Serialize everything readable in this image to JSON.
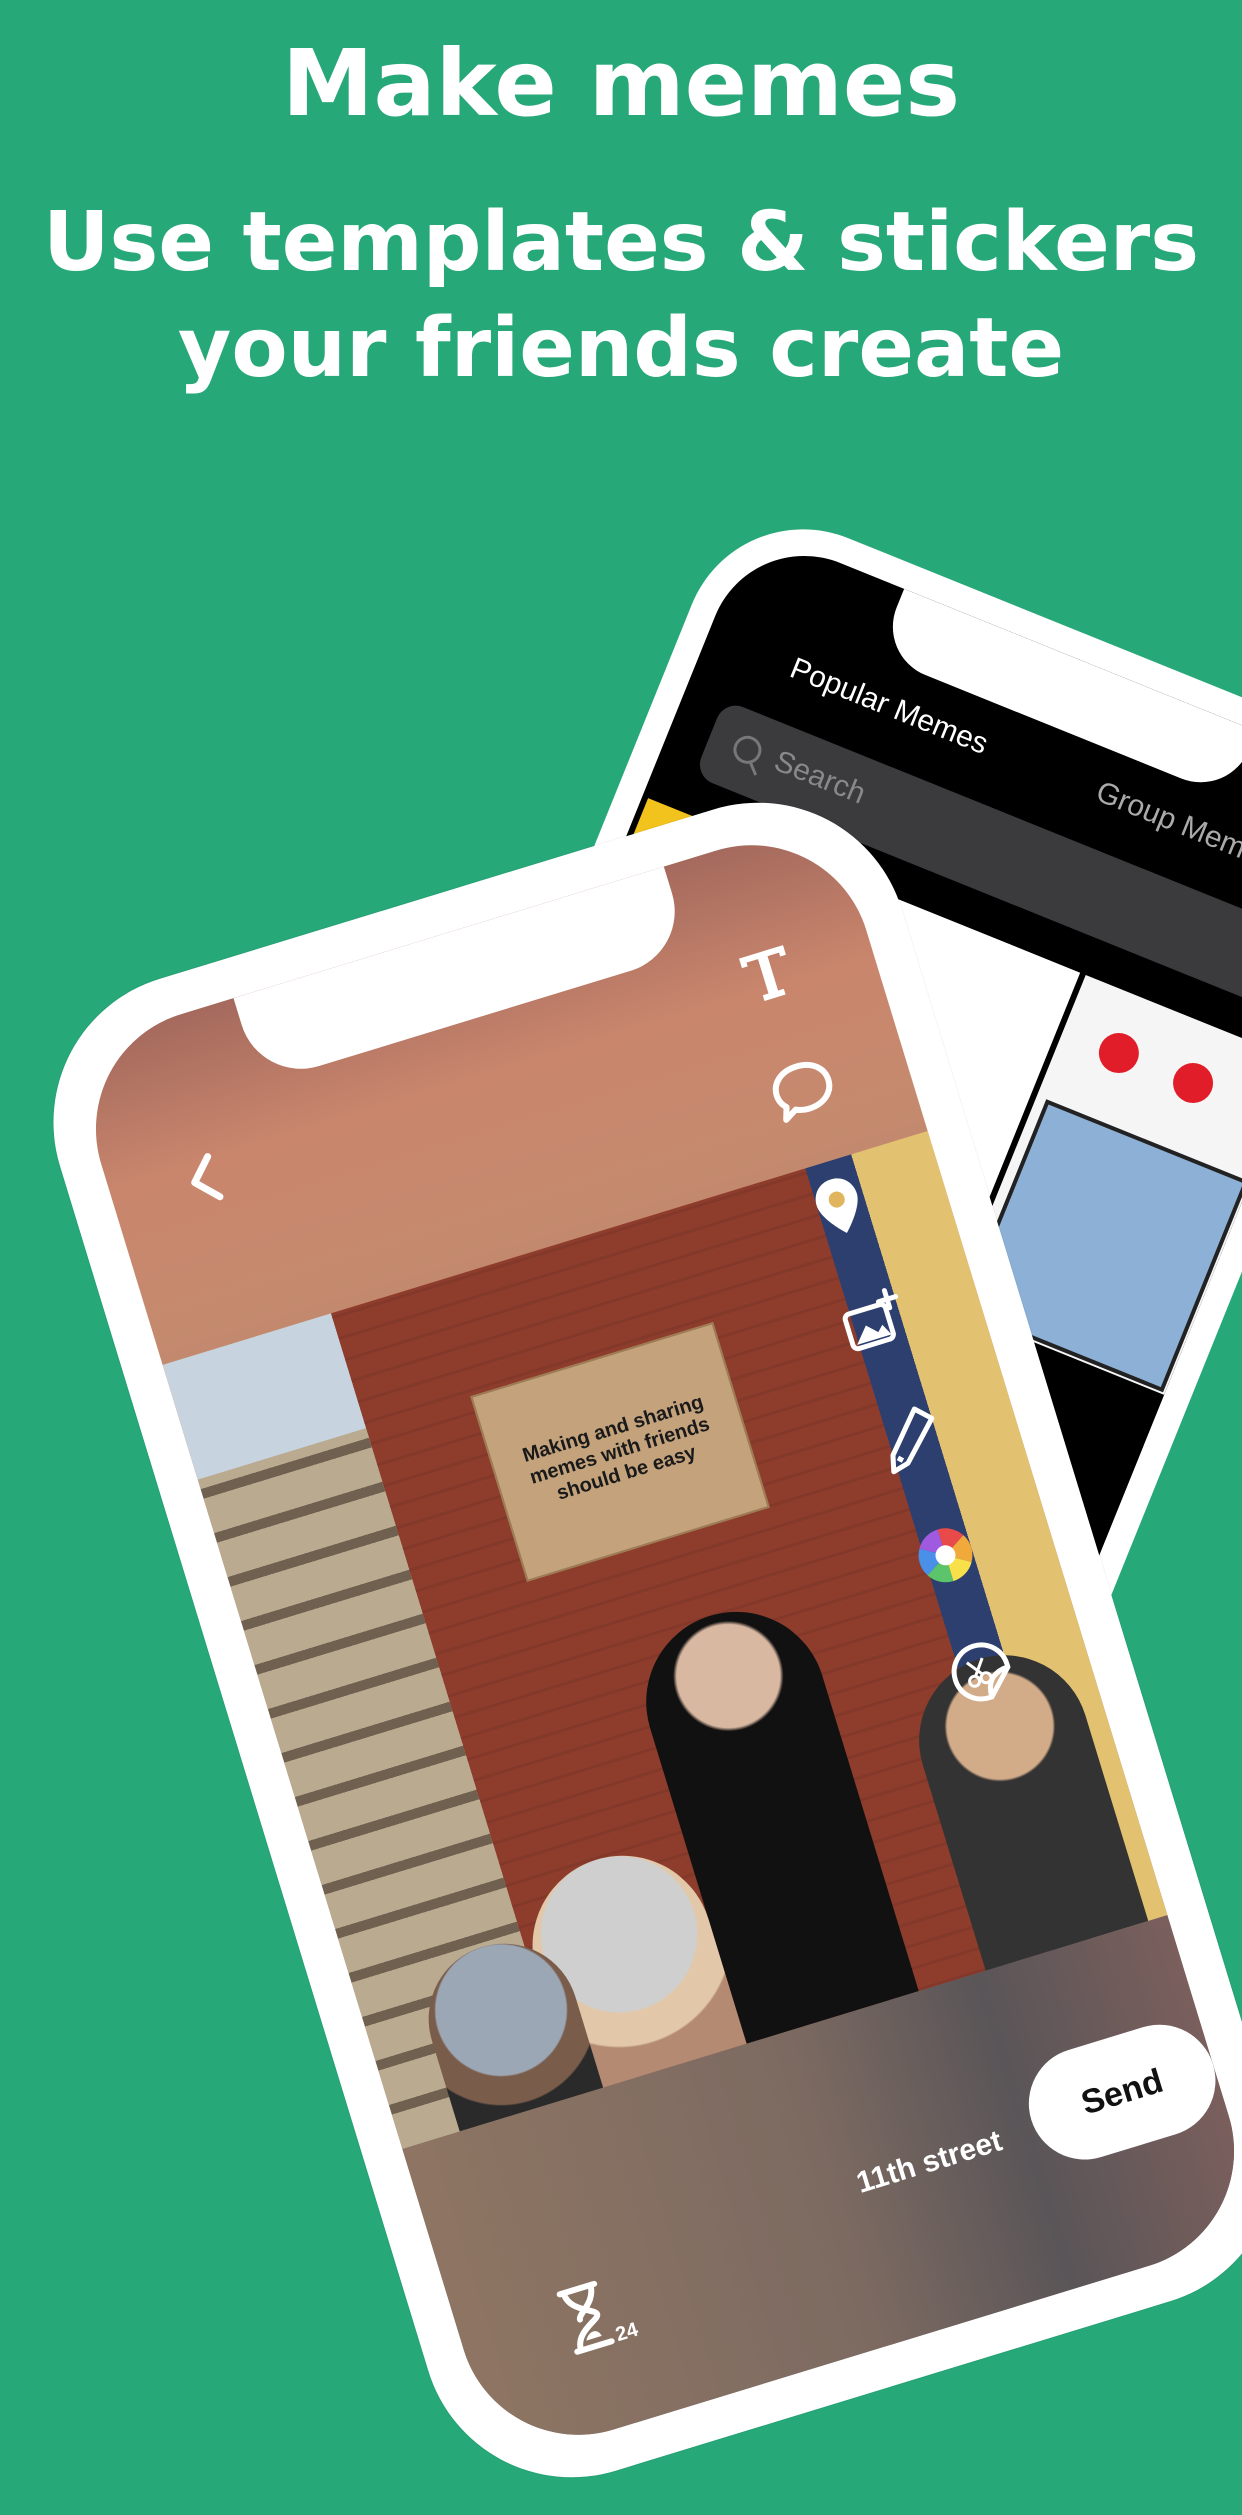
{
  "headline": "Make memes",
  "subheadline": "Use templates & stickers your friends create",
  "back_phone": {
    "tabs": [
      "Popular Memes",
      "Group Memes"
    ],
    "search_placeholder": "Search"
  },
  "front_phone": {
    "sign_text": "Making and sharing memes with friends should be easy",
    "location": "11th street",
    "send_label": "Send",
    "timer_value": "24"
  },
  "colors": {
    "background": "#27a878",
    "white": "#ffffff"
  },
  "icons": {
    "back": "chevron-left-icon",
    "text": "text-t-icon",
    "bubble": "speech-bubble-icon",
    "location": "location-pin-icon",
    "image_add": "image-add-icon",
    "pencil": "pencil-icon",
    "color": "color-wheel-icon",
    "sticker": "sticker-scissors-icon",
    "timer": "hourglass-icon"
  }
}
